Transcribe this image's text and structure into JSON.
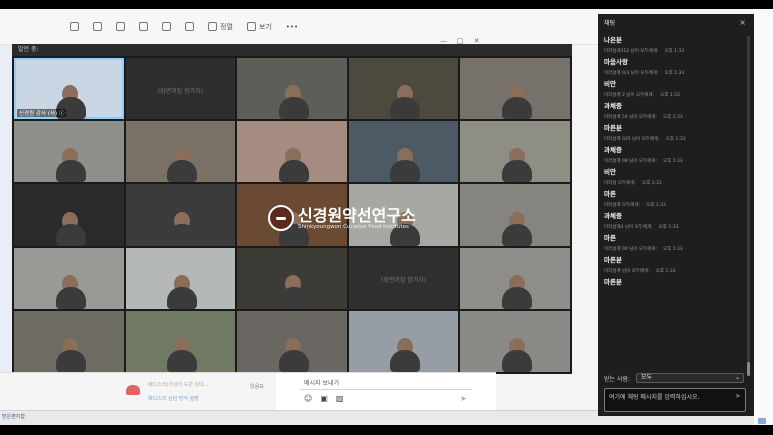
{
  "toolbar": {
    "items": [
      {
        "icon": "reply-icon",
        "label": ""
      },
      {
        "icon": "reply-all-icon",
        "label": ""
      },
      {
        "icon": "forward-icon",
        "label": ""
      },
      {
        "icon": "archive-icon",
        "label": ""
      },
      {
        "icon": "delete-icon",
        "label": ""
      },
      {
        "icon": "tag-icon",
        "label": ""
      },
      {
        "icon": "sort-icon",
        "label": "정렬"
      },
      {
        "icon": "view-icon",
        "label": "보기"
      },
      {
        "icon": "more-icon",
        "label": "•••"
      }
    ]
  },
  "zoom": {
    "title": "발언 중:",
    "tiles": [
      {
        "label": "신경원 강사 (사) ⓘ",
        "center": "",
        "bg": "#c9d6e3",
        "active": true
      },
      {
        "label": "",
        "center": "(화면꺼짐 참가자)",
        "bg": "#2e2e2e",
        "active": false
      },
      {
        "label": "",
        "center": "",
        "bg": "#5e5e58",
        "active": false
      },
      {
        "label": "",
        "center": "",
        "bg": "#4c4a3f",
        "active": false
      },
      {
        "label": "",
        "center": "",
        "bg": "#76716a",
        "active": false
      },
      {
        "label": "",
        "center": "",
        "bg": "#8d8f8a",
        "active": false
      },
      {
        "label": "",
        "center": "",
        "bg": "#7a7165",
        "active": false
      },
      {
        "label": "",
        "center": "",
        "bg": "#a58b80",
        "active": false
      },
      {
        "label": "",
        "center": "",
        "bg": "#4d5a63",
        "active": false
      },
      {
        "label": "",
        "center": "",
        "bg": "#8f8e84",
        "active": false
      },
      {
        "label": "",
        "center": "",
        "bg": "#2a2a2a",
        "active": false
      },
      {
        "label": "",
        "center": "",
        "bg": "#3b3b3b",
        "active": false
      },
      {
        "label": "",
        "center": "",
        "bg": "#6a4a32",
        "active": false
      },
      {
        "label": "",
        "center": "",
        "bg": "#a7a8a4",
        "active": false
      },
      {
        "label": "",
        "center": "",
        "bg": "#86847e",
        "active": false
      },
      {
        "label": "",
        "center": "",
        "bg": "#999a96",
        "active": false
      },
      {
        "label": "",
        "center": "",
        "bg": "#b4b8b7",
        "active": false
      },
      {
        "label": "",
        "center": "",
        "bg": "#3d3b36",
        "active": false
      },
      {
        "label": "",
        "center": "(화면꺼짐 참가자)",
        "bg": "#2f2f2f",
        "active": false
      },
      {
        "label": "",
        "center": "",
        "bg": "#8e8d89",
        "active": false
      },
      {
        "label": "",
        "center": "",
        "bg": "#6e6b63",
        "active": false
      },
      {
        "label": "",
        "center": "",
        "bg": "#707a62",
        "active": false
      },
      {
        "label": "",
        "center": "",
        "bg": "#6a6763",
        "active": false
      },
      {
        "label": "",
        "center": "",
        "bg": "#969da5",
        "active": false
      },
      {
        "label": "",
        "center": "",
        "bg": "#8c8a86",
        "active": false
      }
    ],
    "logo_text": "신경원약선연구소",
    "logo_sub": "Shinkyoungwon Curative Food Institutes"
  },
  "message_area": {
    "left_text": "메디스크(가상의 도관 상대...",
    "left_link": "메디스크 상담 방식 설명",
    "left_corner": "읽음표",
    "placeholder": "메시지 보내기"
  },
  "taskbar": {
    "left_text": "받은편지함"
  },
  "chat": {
    "title": "채팅",
    "close": "×",
    "messages": [
      {
        "meta": "",
        "time": "",
        "text": "나은분"
      },
      {
        "meta": "미라실게312 님이 모두에게:",
        "time": "오후 1:33",
        "text": "마음사랑"
      },
      {
        "meta": "미라설계 0/3 님이 모두에게:",
        "time": "오후 1:33",
        "text": "비만"
      },
      {
        "meta": "미라설계 2 님이 모두에게:",
        "time": "오후 1:33",
        "text": "과체중"
      },
      {
        "meta": "미라설계 54 님이 모두에게:",
        "time": "오후 1:33",
        "text": "마른분"
      },
      {
        "meta": "미라설계 025 님이 모두에게:",
        "time": "오후 1:33",
        "text": "과체중"
      },
      {
        "meta": "미라설계 08 님이 모두에게:",
        "time": "오후 1:33",
        "text": "비만"
      },
      {
        "meta": "미라실 모두에게:",
        "time": "오후 1:33",
        "text": "마른"
      },
      {
        "meta": "미라설계 모두에게:",
        "time": "오후 1:33",
        "text": "과체중"
      },
      {
        "meta": "미라설계4 님이 모두에게:",
        "time": "오후 1:33",
        "text": "마른"
      },
      {
        "meta": "미라설계 00 님이 모두에게:",
        "time": "오후 1:33",
        "text": "마른분"
      },
      {
        "meta": "미라설계 님이 모두에게:",
        "time": "오후 1:33",
        "text": "마른분"
      }
    ],
    "to_label": "받는 사람:",
    "to_value": "모두",
    "input_placeholder": "여기에 채팅 메시지를 입력하십시오."
  }
}
